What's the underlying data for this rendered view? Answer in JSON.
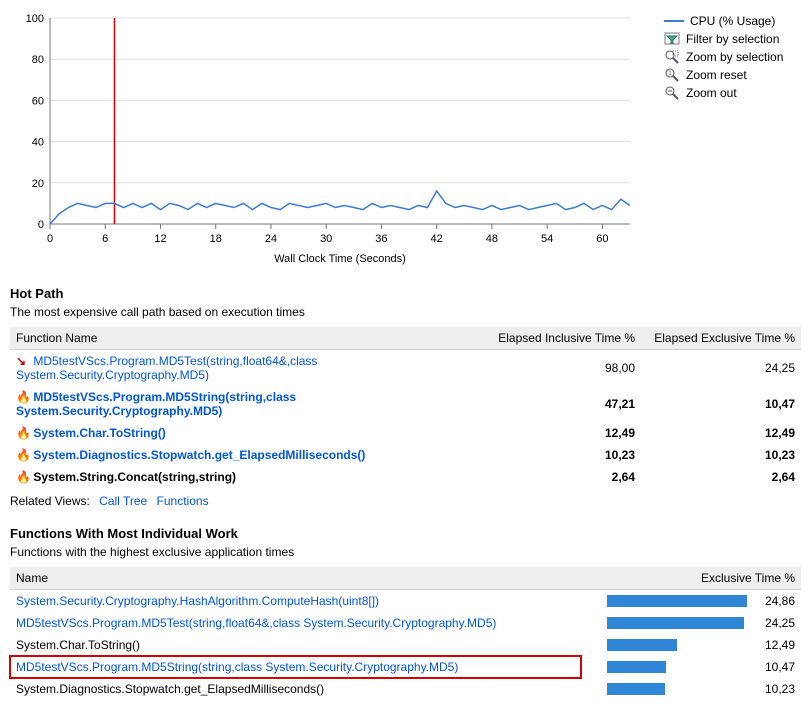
{
  "chart_data": {
    "type": "line",
    "xlabel": "Wall Clock Time (Seconds)",
    "ylabel": "",
    "ylim": [
      0,
      100
    ],
    "xlim": [
      0,
      63
    ],
    "x_ticks": [
      0,
      6,
      12,
      18,
      24,
      30,
      36,
      42,
      48,
      54,
      60
    ],
    "y_ticks": [
      0,
      20,
      40,
      60,
      80,
      100
    ],
    "marker_x": 7,
    "series": [
      {
        "name": "CPU (% Usage)",
        "x": [
          0,
          1,
          2,
          3,
          4,
          5,
          6,
          7,
          8,
          9,
          10,
          11,
          12,
          13,
          14,
          15,
          16,
          17,
          18,
          19,
          20,
          21,
          22,
          23,
          24,
          25,
          26,
          27,
          28,
          29,
          30,
          31,
          32,
          33,
          34,
          35,
          36,
          37,
          38,
          39,
          40,
          41,
          42,
          43,
          44,
          45,
          46,
          47,
          48,
          49,
          50,
          51,
          52,
          53,
          54,
          55,
          56,
          57,
          58,
          59,
          60,
          61,
          62,
          63
        ],
        "values": [
          0,
          5,
          8,
          10,
          9,
          8,
          10,
          10,
          8,
          10,
          8,
          10,
          7,
          10,
          9,
          7,
          10,
          8,
          10,
          9,
          8,
          10,
          7,
          10,
          8,
          7,
          10,
          9,
          8,
          9,
          10,
          8,
          9,
          8,
          7,
          10,
          8,
          9,
          8,
          7,
          9,
          8,
          16,
          10,
          8,
          9,
          8,
          7,
          9,
          7,
          8,
          9,
          7,
          8,
          9,
          10,
          7,
          8,
          10,
          7,
          9,
          7,
          12,
          9
        ]
      }
    ]
  },
  "legend": {
    "cpu": "CPU (% Usage)",
    "filter": "Filter by selection",
    "zoom_sel": "Zoom by selection",
    "zoom_reset": "Zoom reset",
    "zoom_out": "Zoom out"
  },
  "hotpath": {
    "title": "Hot Path",
    "subtitle": "The most expensive call path based on execution times",
    "col_name": "Function Name",
    "col_incl": "Elapsed Inclusive Time %",
    "col_excl": "Elapsed Exclusive Time %",
    "rows": [
      {
        "icon": "arrow",
        "indent": 1,
        "link": true,
        "bold": false,
        "name": "MD5testVScs.Program.MD5Test(string,float64&,class System.Security.Cryptography.MD5)",
        "incl": "98,00",
        "excl": "24,25"
      },
      {
        "icon": "flame",
        "indent": 2,
        "link": true,
        "bold": true,
        "name": "MD5testVScs.Program.MD5String(string,class System.Security.Cryptography.MD5)",
        "incl": "47,21",
        "excl": "10,47"
      },
      {
        "icon": "flame",
        "indent": 2,
        "link": true,
        "bold": true,
        "name": "System.Char.ToString()",
        "incl": "12,49",
        "excl": "12,49"
      },
      {
        "icon": "flame",
        "indent": 2,
        "link": true,
        "bold": true,
        "name": "System.Diagnostics.Stopwatch.get_ElapsedMilliseconds()",
        "incl": "10,23",
        "excl": "10,23"
      },
      {
        "icon": "flame",
        "indent": 2,
        "link": false,
        "bold": true,
        "name": "System.String.Concat(string,string)",
        "incl": "2,64",
        "excl": "2,64"
      }
    ]
  },
  "related": {
    "label": "Related Views:",
    "link1": "Call Tree",
    "link2": "Functions"
  },
  "funcwork": {
    "title": "Functions With Most Individual Work",
    "subtitle": "Functions with the highest exclusive application times",
    "col_name": "Name",
    "col_excl": "Exclusive Time %",
    "rows": [
      {
        "name": "System.Security.Cryptography.HashAlgorithm.ComputeHash(uint8[])",
        "link": true,
        "hl": false,
        "pct": 24.86,
        "pct_s": "24,86"
      },
      {
        "name": "MD5testVScs.Program.MD5Test(string,float64&,class System.Security.Cryptography.MD5)",
        "link": true,
        "hl": false,
        "pct": 24.25,
        "pct_s": "24,25"
      },
      {
        "name": "System.Char.ToString()",
        "link": false,
        "hl": false,
        "pct": 12.49,
        "pct_s": "12,49"
      },
      {
        "name": "MD5testVScs.Program.MD5String(string,class System.Security.Cryptography.MD5)",
        "link": true,
        "hl": true,
        "pct": 10.47,
        "pct_s": "10,47"
      },
      {
        "name": "System.Diagnostics.Stopwatch.get_ElapsedMilliseconds()",
        "link": false,
        "hl": false,
        "pct": 10.23,
        "pct_s": "10,23"
      }
    ]
  }
}
